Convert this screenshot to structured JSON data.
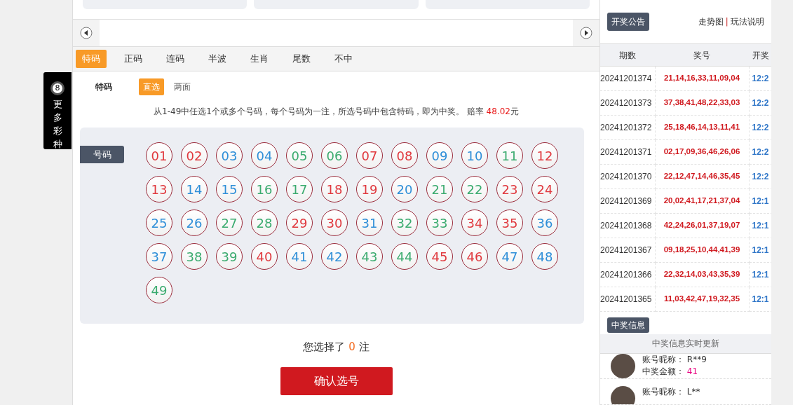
{
  "side_tab": {
    "badge": "8",
    "label": "更多彩种"
  },
  "tabs": [
    {
      "label": "特码",
      "selected": true
    },
    {
      "label": "正码",
      "selected": false
    },
    {
      "label": "连码",
      "selected": false
    },
    {
      "label": "半波",
      "selected": false
    },
    {
      "label": "生肖",
      "selected": false
    },
    {
      "label": "尾数",
      "selected": false
    },
    {
      "label": "不中",
      "selected": false
    }
  ],
  "play_label": "特码",
  "modes": [
    {
      "label": "直选",
      "selected": true
    },
    {
      "label": "两面",
      "selected": false
    }
  ],
  "description": {
    "text": "从1-49中任选1个或多个号码，每个号码为一注，所选号码中包含特码，即为中奖。 赔率 ",
    "odds": "48.02",
    "unit": "元"
  },
  "number_panel": {
    "label": "号码",
    "balls": [
      {
        "number": "01",
        "color": "#e0393e",
        "selected": false
      },
      {
        "number": "02",
        "color": "#e0393e",
        "selected": false
      },
      {
        "number": "03",
        "color": "#2f8fd8",
        "selected": false
      },
      {
        "number": "04",
        "color": "#2f8fd8",
        "selected": false
      },
      {
        "number": "05",
        "color": "#3bab6f",
        "selected": false
      },
      {
        "number": "06",
        "color": "#3bab6f",
        "selected": false
      },
      {
        "number": "07",
        "color": "#e0393e",
        "selected": false
      },
      {
        "number": "08",
        "color": "#e0393e",
        "selected": false
      },
      {
        "number": "09",
        "color": "#2f8fd8",
        "selected": false
      },
      {
        "number": "10",
        "color": "#2f8fd8",
        "selected": false
      },
      {
        "number": "11",
        "color": "#3bab6f",
        "selected": false
      },
      {
        "number": "12",
        "color": "#e0393e",
        "selected": false
      },
      {
        "number": "13",
        "color": "#e0393e",
        "selected": false
      },
      {
        "number": "14",
        "color": "#2f8fd8",
        "selected": false
      },
      {
        "number": "15",
        "color": "#2f8fd8",
        "selected": false
      },
      {
        "number": "16",
        "color": "#3bab6f",
        "selected": false
      },
      {
        "number": "17",
        "color": "#3bab6f",
        "selected": false
      },
      {
        "number": "18",
        "color": "#e0393e",
        "selected": false
      },
      {
        "number": "19",
        "color": "#e0393e",
        "selected": false
      },
      {
        "number": "20",
        "color": "#2f8fd8",
        "selected": false
      },
      {
        "number": "21",
        "color": "#3bab6f",
        "selected": false
      },
      {
        "number": "22",
        "color": "#3bab6f",
        "selected": false
      },
      {
        "number": "23",
        "color": "#e0393e",
        "selected": false
      },
      {
        "number": "24",
        "color": "#e0393e",
        "selected": false
      },
      {
        "number": "25",
        "color": "#2f8fd8",
        "selected": false
      },
      {
        "number": "26",
        "color": "#2f8fd8",
        "selected": false
      },
      {
        "number": "27",
        "color": "#3bab6f",
        "selected": false
      },
      {
        "number": "28",
        "color": "#3bab6f",
        "selected": false
      },
      {
        "number": "29",
        "color": "#e0393e",
        "selected": false
      },
      {
        "number": "30",
        "color": "#e0393e",
        "selected": false
      },
      {
        "number": "31",
        "color": "#2f8fd8",
        "selected": false
      },
      {
        "number": "32",
        "color": "#3bab6f",
        "selected": false
      },
      {
        "number": "33",
        "color": "#3bab6f",
        "selected": false
      },
      {
        "number": "34",
        "color": "#e0393e",
        "selected": false
      },
      {
        "number": "35",
        "color": "#e0393e",
        "selected": false
      },
      {
        "number": "36",
        "color": "#2f8fd8",
        "selected": false
      },
      {
        "number": "37",
        "color": "#2f8fd8",
        "selected": false
      },
      {
        "number": "38",
        "color": "#3bab6f",
        "selected": false
      },
      {
        "number": "39",
        "color": "#3bab6f",
        "selected": false
      },
      {
        "number": "40",
        "color": "#e0393e",
        "selected": false
      },
      {
        "number": "41",
        "color": "#2f8fd8",
        "selected": false
      },
      {
        "number": "42",
        "color": "#2f8fd8",
        "selected": false
      },
      {
        "number": "43",
        "color": "#3bab6f",
        "selected": false
      },
      {
        "number": "44",
        "color": "#3bab6f",
        "selected": false
      },
      {
        "number": "45",
        "color": "#e0393e",
        "selected": false
      },
      {
        "number": "46",
        "color": "#e0393e",
        "selected": false
      },
      {
        "number": "47",
        "color": "#2f8fd8",
        "selected": false
      },
      {
        "number": "48",
        "color": "#2f8fd8",
        "selected": false
      },
      {
        "number": "49",
        "color": "#3bab6f",
        "selected": false
      }
    ]
  },
  "selection_summary": {
    "prefix": "您选择了",
    "count": "0",
    "suffix": "注"
  },
  "confirm_button": "确认选号",
  "results_panel": {
    "title": "开奖公告",
    "links": [
      "走势图",
      "玩法说明"
    ],
    "link_separator": "|",
    "columns": [
      "期数",
      "奖号",
      "开奖"
    ],
    "rows": [
      {
        "period": "20241201374",
        "numbers": "21,14,16,33,11,09,04",
        "time": "12:2"
      },
      {
        "period": "20241201373",
        "numbers": "37,38,41,48,22,33,03",
        "time": "12:2"
      },
      {
        "period": "20241201372",
        "numbers": "25,18,46,14,13,11,41",
        "time": "12:2"
      },
      {
        "period": "20241201371",
        "numbers": "02,17,09,36,46,26,06",
        "time": "12:2"
      },
      {
        "period": "20241201370",
        "numbers": "22,12,47,14,46,35,45",
        "time": "12:2"
      },
      {
        "period": "20241201369",
        "numbers": "20,02,41,17,21,37,04",
        "time": "12:1"
      },
      {
        "period": "20241201368",
        "numbers": "42,24,26,01,37,19,07",
        "time": "12:1"
      },
      {
        "period": "20241201367",
        "numbers": "09,18,25,10,44,41,39",
        "time": "12:1"
      },
      {
        "period": "20241201366",
        "numbers": "22,32,14,03,43,35,39",
        "time": "12:1"
      },
      {
        "period": "20241201365",
        "numbers": "11,03,42,47,19,32,35",
        "time": "12:1"
      }
    ]
  },
  "winners_panel": {
    "title": "中奖信息",
    "banner": "中奖信息实时更新",
    "entries": [
      {
        "nickname_label": "账号昵称：",
        "nickname": "R**9",
        "amount_label": "中奖金额：",
        "amount": "41"
      },
      {
        "nickname_label": "账号昵称：",
        "nickname": "L**"
      }
    ]
  }
}
